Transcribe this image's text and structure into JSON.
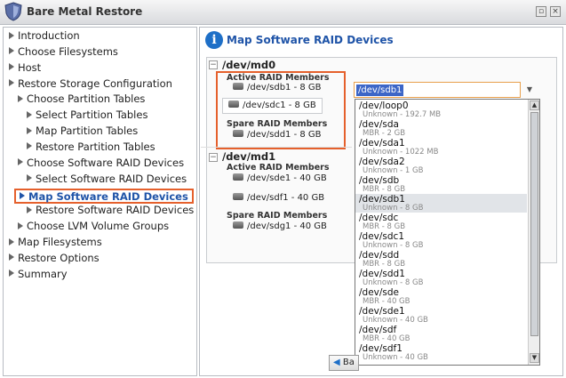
{
  "window": {
    "title": "Bare Metal Restore"
  },
  "nav": [
    {
      "label": "Introduction",
      "indent": 0
    },
    {
      "label": "Choose Filesystems",
      "indent": 0
    },
    {
      "label": "Host",
      "indent": 0
    },
    {
      "label": "Restore Storage Configuration",
      "indent": 0
    },
    {
      "label": "Choose Partition Tables",
      "indent": 1
    },
    {
      "label": "Select Partition Tables",
      "indent": 2
    },
    {
      "label": "Map Partition Tables",
      "indent": 2
    },
    {
      "label": "Restore Partition Tables",
      "indent": 2
    },
    {
      "label": "Choose Software RAID Devices",
      "indent": 1
    },
    {
      "label": "Select Software RAID Devices",
      "indent": 2
    },
    {
      "label": "Map Software RAID Devices",
      "indent": 1,
      "active": true
    },
    {
      "label": "Restore Software RAID Devices",
      "indent": 2
    },
    {
      "label": "Choose LVM Volume Groups",
      "indent": 1
    },
    {
      "label": "Map Filesystems",
      "indent": 0
    },
    {
      "label": "Restore Options",
      "indent": 0
    },
    {
      "label": "Summary",
      "indent": 0
    }
  ],
  "main": {
    "title": "Map Software RAID Devices",
    "devices": [
      {
        "name": "/dev/md0",
        "active_label": "Active RAID Members",
        "active": [
          "/dev/sdb1 - 8 GB",
          "/dev/sdc1 - 8 GB"
        ],
        "spare_label": "Spare RAID Members",
        "spare": [
          "/dev/sdd1 - 8 GB"
        ]
      },
      {
        "name": "/dev/md1",
        "active_label": "Active RAID Members",
        "active": [
          "/dev/sde1 - 40 GB",
          "/dev/sdf1 - 40 GB"
        ],
        "spare_label": "Spare RAID Members",
        "spare": [
          "/dev/sdg1 - 40 GB"
        ]
      }
    ],
    "combo_value": "/dev/sdb1",
    "dropdown": [
      {
        "name": "/dev/loop0",
        "desc": "Unknown - 192.7 MB"
      },
      {
        "name": "/dev/sda",
        "desc": "MBR - 2 GB"
      },
      {
        "name": "/dev/sda1",
        "desc": "Unknown - 1022 MB"
      },
      {
        "name": "/dev/sda2",
        "desc": "Unknown - 1 GB"
      },
      {
        "name": "/dev/sdb",
        "desc": "MBR - 8 GB"
      },
      {
        "name": "/dev/sdb1",
        "desc": "Unknown - 8 GB",
        "selected": true
      },
      {
        "name": "/dev/sdc",
        "desc": "MBR - 8 GB"
      },
      {
        "name": "/dev/sdc1",
        "desc": "Unknown - 8 GB"
      },
      {
        "name": "/dev/sdd",
        "desc": "MBR - 8 GB"
      },
      {
        "name": "/dev/sdd1",
        "desc": "Unknown - 8 GB"
      },
      {
        "name": "/dev/sde",
        "desc": "MBR - 40 GB"
      },
      {
        "name": "/dev/sde1",
        "desc": "Unknown - 40 GB"
      },
      {
        "name": "/dev/sdf",
        "desc": "MBR - 40 GB"
      },
      {
        "name": "/dev/sdf1",
        "desc": "Unknown - 40 GB"
      }
    ],
    "back_button": "Ba"
  },
  "colors": {
    "accent": "#1f54a8",
    "highlight_border": "#e5602c",
    "selection": "#3d66c7"
  }
}
